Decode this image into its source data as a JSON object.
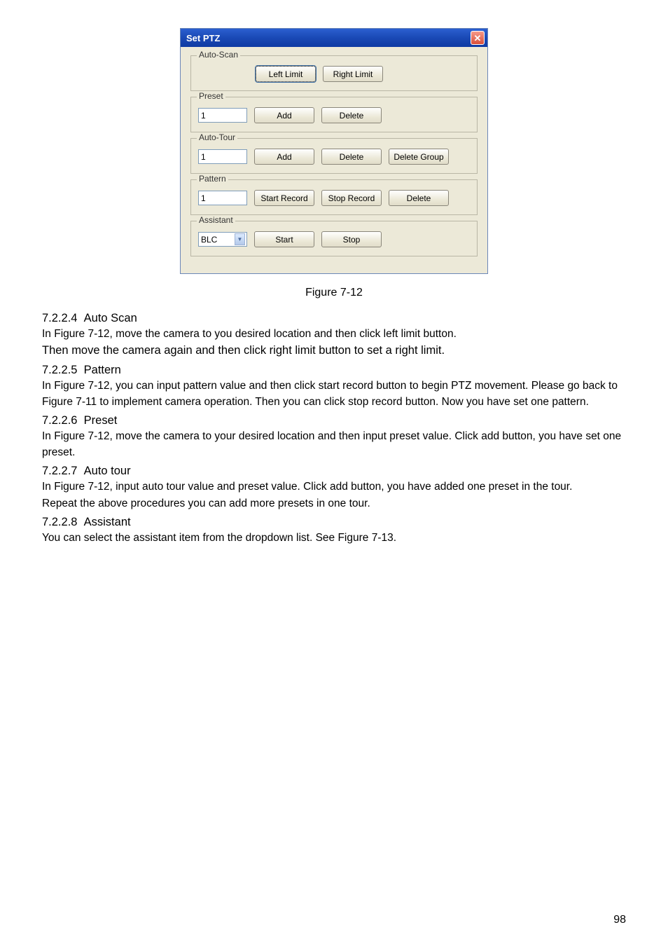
{
  "dialog": {
    "title": "Set PTZ",
    "groups": {
      "autoScan": {
        "legend": "Auto-Scan",
        "leftLimit": "Left Limit",
        "rightLimit": "Right Limit"
      },
      "preset": {
        "legend": "Preset",
        "value": "1",
        "add": "Add",
        "delete": "Delete"
      },
      "autoTour": {
        "legend": "Auto-Tour",
        "value": "1",
        "add": "Add",
        "delete": "Delete",
        "deleteGroup": "Delete Group"
      },
      "pattern": {
        "legend": "Pattern",
        "value": "1",
        "startRecord": "Start Record",
        "stopRecord": "Stop Record",
        "delete": "Delete"
      },
      "assistant": {
        "legend": "Assistant",
        "selected": "BLC",
        "start": "Start",
        "stop": "Stop"
      }
    }
  },
  "figureCaption": "Figure 7-12",
  "sections": {
    "autoScan": {
      "num": "7.2.2.4",
      "title": "Auto Scan",
      "p1": "In Figure 7-12, move the camera to you desired location and then click left limit button.",
      "p2": "Then move the camera again and then click right limit button to set a right limit."
    },
    "pattern": {
      "num": "7.2.2.5",
      "title": "Pattern",
      "p1": "In Figure 7-12, you can input pattern value and then click start record button to begin PTZ movement. Please go back to Figure 7-11 to implement camera operation. Then you can click stop record button. Now you have set one pattern."
    },
    "preset": {
      "num": "7.2.2.6",
      "title": "Preset",
      "p1": "In Figure 7-12, move the camera to your desired location and then input preset value. Click add button, you have set one preset."
    },
    "autoTour": {
      "num": "7.2.2.7",
      "title": "Auto tour",
      "p1": "In Figure 7-12, input auto tour value and preset value. Click add button, you have added one preset in the tour.",
      "p2": "Repeat the above procedures you can add more presets in one tour."
    },
    "assistant": {
      "num": "7.2.2.8",
      "title": "Assistant",
      "p1": "You can select the assistant item from the dropdown list. See Figure 7-13."
    }
  },
  "pageNumber": "98"
}
